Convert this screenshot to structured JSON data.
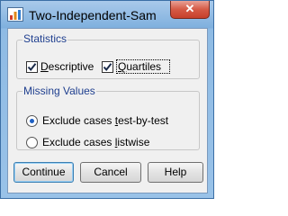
{
  "window": {
    "title": "Two-Independent-Sam",
    "close_glyph": "✕"
  },
  "statistics": {
    "label": "Statistics",
    "descriptive": {
      "label": "Descriptive",
      "checked": true
    },
    "quartiles": {
      "label": "Quartiles",
      "checked": true
    }
  },
  "missing_values": {
    "label": "Missing Values",
    "options": [
      {
        "label": "Exclude cases test-by-test",
        "selected": true
      },
      {
        "label": "Exclude cases listwise",
        "selected": false
      }
    ]
  },
  "buttons": {
    "continue": "Continue",
    "cancel": "Cancel",
    "help": "Help"
  },
  "colors": {
    "group_label": "#1f3f8f",
    "close_button": "#d55a45",
    "radio_dot": "#1d5fc3"
  }
}
